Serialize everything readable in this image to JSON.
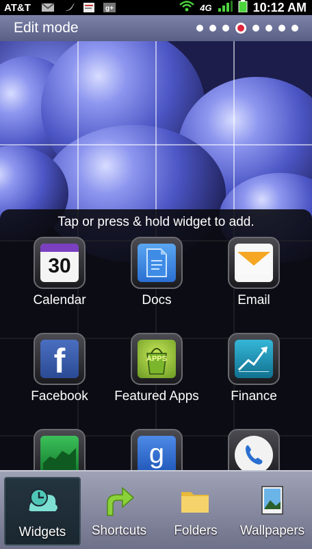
{
  "status_bar": {
    "carrier": "AT&T",
    "network": "4G",
    "time": "10:12 AM"
  },
  "header": {
    "title": "Edit mode",
    "pages_total": 8,
    "active_page": 4
  },
  "widget_panel": {
    "hint": "Tap or press & hold widget to add.",
    "apps": [
      {
        "label": "Calendar",
        "icon": "calendar-icon",
        "badge": "30"
      },
      {
        "label": "Docs",
        "icon": "docs-icon"
      },
      {
        "label": "Email",
        "icon": "email-icon"
      },
      {
        "label": "Facebook",
        "icon": "facebook-icon",
        "glyph": "f"
      },
      {
        "label": "Featured Apps",
        "icon": "featured-apps-icon",
        "glyph": "APPS"
      },
      {
        "label": "Finance",
        "icon": "finance-icon"
      },
      {
        "label": "",
        "icon": "stocks-icon"
      },
      {
        "label": "",
        "icon": "google-search-icon",
        "glyph": "g"
      },
      {
        "label": "",
        "icon": "phone-icon"
      }
    ]
  },
  "dock": {
    "items": [
      {
        "label": "Widgets",
        "icon": "widgets-icon",
        "active": true
      },
      {
        "label": "Shortcuts",
        "icon": "shortcuts-arrow-icon"
      },
      {
        "label": "Folders",
        "icon": "folder-icon"
      },
      {
        "label": "Wallpapers",
        "icon": "wallpapers-icon"
      }
    ]
  },
  "colors": {
    "active_page_dot": "#e0243e",
    "dock_active_bg": "#1a2730"
  }
}
